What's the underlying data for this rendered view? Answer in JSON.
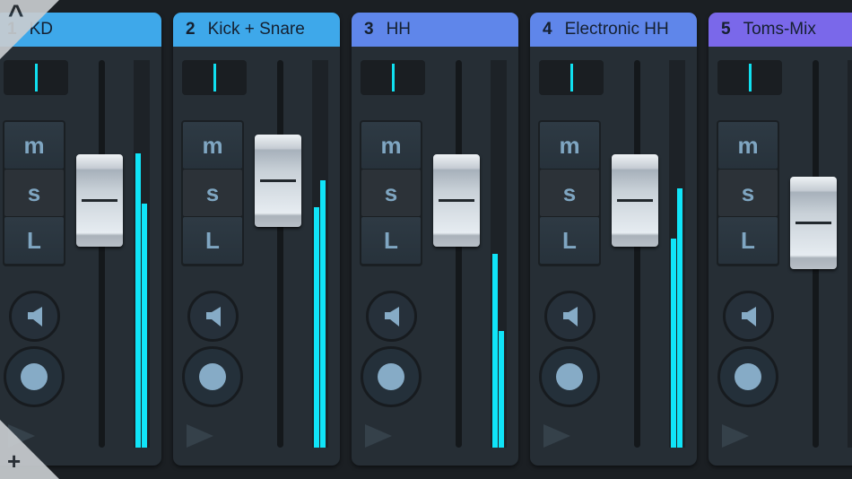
{
  "channels": [
    {
      "number": "1",
      "name": "KD",
      "color": "#3ea8ea",
      "fader": 0.64,
      "pan": 0,
      "meter": [
        0.76,
        0.63
      ],
      "buttons": [
        "m",
        "s",
        "L"
      ]
    },
    {
      "number": "2",
      "name": "Kick + Snare",
      "color": "#3ea8ea",
      "fader": 0.69,
      "pan": 0,
      "meter": [
        0.62,
        0.69
      ],
      "buttons": [
        "m",
        "s",
        "L"
      ]
    },
    {
      "number": "3",
      "name": "HH",
      "color": "#5f86ea",
      "fader": 0.64,
      "pan": 0,
      "meter": [
        0.5,
        0.3
      ],
      "buttons": [
        "m",
        "s",
        "L"
      ]
    },
    {
      "number": "4",
      "name": "Electronic HH",
      "color": "#5f86ea",
      "fader": 0.64,
      "pan": 0,
      "meter": [
        0.54,
        0.67
      ],
      "buttons": [
        "m",
        "s",
        "L"
      ]
    },
    {
      "number": "5",
      "name": "Toms-Mix",
      "color": "#7a68ea",
      "fader": 0.58,
      "pan": 0,
      "meter": [
        0,
        0
      ],
      "buttons": [
        "m",
        "s",
        "L"
      ]
    }
  ],
  "corners": {
    "top_icon": "chevron-up-icon",
    "top_glyph": "^",
    "bottom_icon": "plus-icon",
    "bottom_glyph": "+"
  }
}
